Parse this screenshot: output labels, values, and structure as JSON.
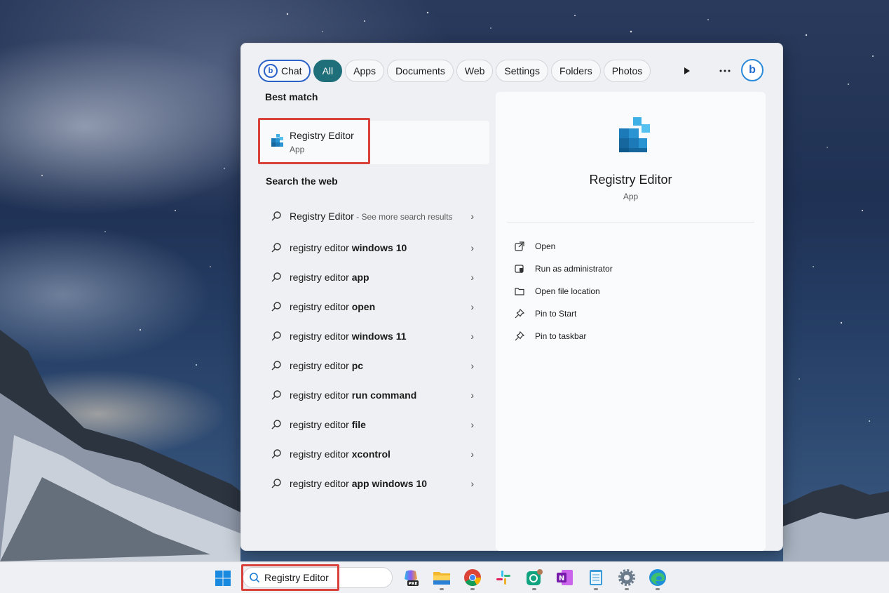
{
  "filters": {
    "chat_label": "Chat",
    "tabs": [
      "All",
      "Apps",
      "Documents",
      "Web",
      "Settings",
      "Folders",
      "Photos"
    ],
    "active_tab": "All"
  },
  "best_match": {
    "heading": "Best match",
    "title": "Registry Editor",
    "subtitle": "App"
  },
  "web": {
    "heading": "Search the web",
    "first": {
      "title": "Registry Editor",
      "suffix": " - See more search results"
    },
    "items": [
      {
        "prefix": "registry editor ",
        "bold": "windows 10"
      },
      {
        "prefix": "registry editor ",
        "bold": "app"
      },
      {
        "prefix": "registry editor ",
        "bold": "open"
      },
      {
        "prefix": "registry editor ",
        "bold": "windows 11"
      },
      {
        "prefix": "registry editor ",
        "bold": "pc"
      },
      {
        "prefix": "registry editor ",
        "bold": "run command"
      },
      {
        "prefix": "registry editor ",
        "bold": "file"
      },
      {
        "prefix": "registry editor ",
        "bold": "xcontrol"
      },
      {
        "prefix": "registry editor ",
        "bold": "app windows 10"
      }
    ]
  },
  "detail": {
    "title": "Registry Editor",
    "subtitle": "App",
    "actions": [
      {
        "icon": "open-icon",
        "label": "Open"
      },
      {
        "icon": "shield-icon",
        "label": "Run as administrator"
      },
      {
        "icon": "folder-icon",
        "label": "Open file location"
      },
      {
        "icon": "pin-icon",
        "label": "Pin to Start"
      },
      {
        "icon": "pin-icon",
        "label": "Pin to taskbar"
      }
    ]
  },
  "taskbar": {
    "search_value": "Registry Editor",
    "apps": [
      "copilot-icon",
      "file-explorer-icon",
      "chrome-icon",
      "slack-icon",
      "chatgpt-icon",
      "onenote-icon",
      "notepad-icon",
      "settings-icon",
      "edge-icon"
    ],
    "copilot_badge": "PRE"
  },
  "colors": {
    "accent": "#1f6f7a",
    "highlight": "#d9423a",
    "bing_blue": "#2a62c9"
  }
}
